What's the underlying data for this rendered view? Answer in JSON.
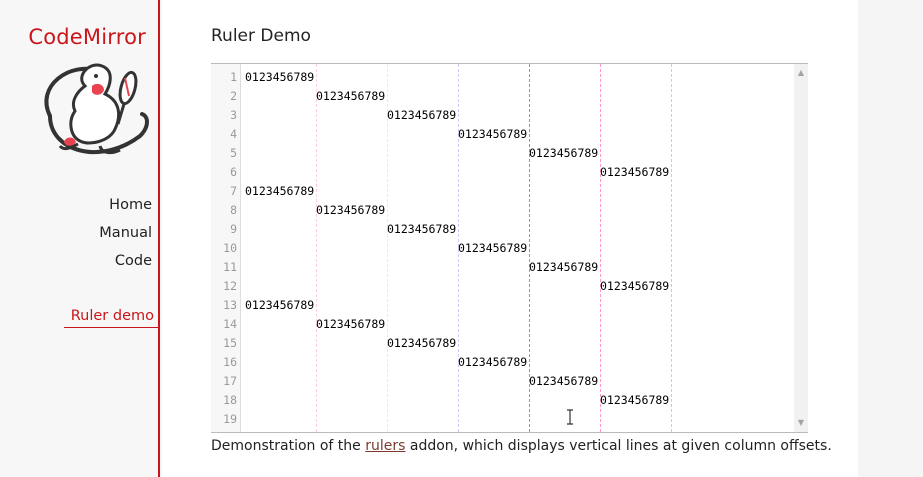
{
  "sidebar": {
    "logo_text": "CodeMirror",
    "nav": [
      {
        "label": "Home"
      },
      {
        "label": "Manual"
      },
      {
        "label": "Code"
      }
    ],
    "current": "Ruler demo"
  },
  "main": {
    "title": "Ruler Demo",
    "description": {
      "before": "Demonstration of the ",
      "link": "rulers",
      "after": " addon, which displays vertical lines at given column offsets."
    }
  },
  "editor": {
    "line_numbers": [
      "1",
      "2",
      "3",
      "4",
      "5",
      "6",
      "7",
      "8",
      "9",
      "10",
      "11",
      "12",
      "13",
      "14",
      "15",
      "16",
      "17",
      "18",
      "19"
    ],
    "lines": [
      {
        "indent": 0,
        "text": "0123456789"
      },
      {
        "indent": 10,
        "text": "0123456789"
      },
      {
        "indent": 20,
        "text": "0123456789"
      },
      {
        "indent": 30,
        "text": "0123456789"
      },
      {
        "indent": 40,
        "text": "0123456789"
      },
      {
        "indent": 50,
        "text": "0123456789"
      },
      {
        "indent": 0,
        "text": "0123456789"
      },
      {
        "indent": 10,
        "text": "0123456789"
      },
      {
        "indent": 20,
        "text": "0123456789"
      },
      {
        "indent": 30,
        "text": "0123456789"
      },
      {
        "indent": 40,
        "text": "0123456789"
      },
      {
        "indent": 50,
        "text": "0123456789"
      },
      {
        "indent": 0,
        "text": "0123456789"
      },
      {
        "indent": 10,
        "text": "0123456789"
      },
      {
        "indent": 20,
        "text": "0123456789"
      },
      {
        "indent": 30,
        "text": "0123456789"
      },
      {
        "indent": 40,
        "text": "0123456789"
      },
      {
        "indent": 50,
        "text": "0123456789"
      },
      {
        "indent": 0,
        "text": ""
      }
    ],
    "rulers": [
      {
        "column": 10,
        "color": "#fcd"
      },
      {
        "column": 20,
        "color": "#cfc"
      },
      {
        "column": 30,
        "color": "#ccf"
      },
      {
        "column": 40,
        "color": "#999"
      },
      {
        "column": 50,
        "color": "#f9c"
      },
      {
        "column": 60,
        "color": "#ccc"
      }
    ],
    "scroll_up_icon": "triangle-up",
    "scroll_down_icon": "triangle-down"
  },
  "colors": {
    "accent": "#c9161b",
    "link": "#7a3b2e"
  }
}
